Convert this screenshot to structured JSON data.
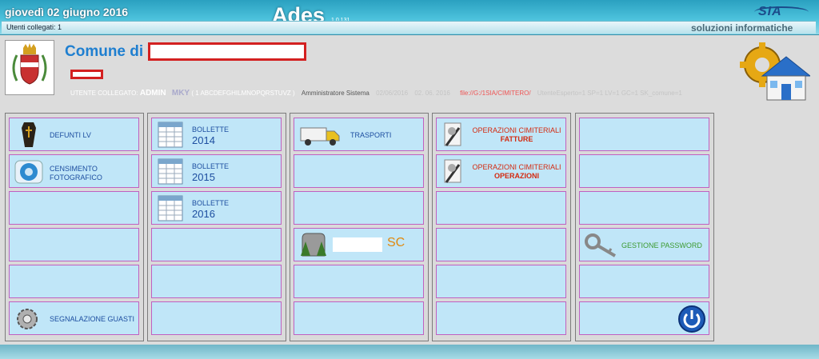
{
  "header": {
    "date": "giovedì 02 giugno 2016",
    "app_title": "Ades",
    "version": "1.0.131",
    "users_online": "Utenti collegati: 1",
    "brand": "soluzioni informatiche",
    "vendor_logo": "SIA"
  },
  "comune": {
    "label": "Comune di"
  },
  "user_info": {
    "prefix": "UTENTE COLLEGATO:",
    "user": "ADMIN",
    "code": "MKY",
    "letters": "( 1 ABCDEFGHILMNOPQRSTUVZ )",
    "role": "Amministratore Sistema",
    "date1": "02/06/2016",
    "date2": "02. 06. 2016",
    "path": "file://G:/1SIA/CIMITERO/",
    "params": "UtenteEsperto=1  SP=1  LV=1  GC=1  SK_comune=1"
  },
  "columns": [
    {
      "tiles": [
        {
          "icon": "coffin-icon",
          "lines": [
            "DEFUNTI LV"
          ]
        },
        {
          "icon": "camera-icon",
          "lines": [
            "CENSIMENTO",
            "FOTOGRAFICO"
          ]
        },
        {},
        {},
        {},
        {
          "icon": "gear-icon",
          "lines": [
            "SEGNALAZIONE GUASTI"
          ]
        }
      ]
    },
    {
      "tiles": [
        {
          "icon": "calendar-icon",
          "lines": [
            "BOLLETTE"
          ],
          "year": "2014"
        },
        {
          "icon": "calendar-icon",
          "lines": [
            "BOLLETTE"
          ],
          "year": "2015"
        },
        {
          "icon": "calendar-icon",
          "lines": [
            "BOLLETTE"
          ],
          "year": "2016"
        },
        {},
        {},
        {}
      ]
    },
    {
      "tiles": [
        {
          "icon": "truck-icon",
          "lines": [
            "TRASPORTI"
          ]
        },
        {},
        {},
        {
          "icon": "tomb-icon",
          "suffix": "SC"
        },
        {},
        {}
      ]
    },
    {
      "tiles": [
        {
          "icon": "document-pen-icon",
          "lines": [
            "OPERAZIONI CIMITERIALI"
          ],
          "strong": "FATTURE"
        },
        {
          "icon": "document-pen-icon",
          "lines": [
            "OPERAZIONI CIMITERIALI"
          ],
          "strong": "OPERAZIONI"
        },
        {},
        {},
        {},
        {}
      ]
    },
    {
      "tiles": [
        {},
        {},
        {},
        {
          "icon": "key-icon",
          "lines": [
            "GESTIONE PASSWORD"
          ]
        },
        {},
        {
          "icon": "power-icon"
        }
      ]
    }
  ]
}
